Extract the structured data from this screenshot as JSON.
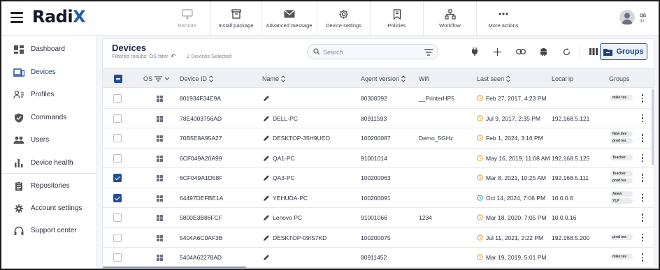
{
  "app": {
    "logo_text": "Radi",
    "logo_accent": "X"
  },
  "toolbar": [
    {
      "label": "Remote",
      "icon": "monitor-icon",
      "disabled": true
    },
    {
      "label": "Install package",
      "icon": "package-icon",
      "disabled": false
    },
    {
      "label": "Advanced message",
      "icon": "envelope-icon",
      "disabled": false
    },
    {
      "label": "Device settings",
      "icon": "gear-icon",
      "disabled": false
    },
    {
      "label": "Policies",
      "icon": "bookmark-icon",
      "disabled": false
    },
    {
      "label": "Workflow",
      "icon": "workflow-icon",
      "disabled": false
    },
    {
      "label": "More actions",
      "icon": "more-dots-icon",
      "disabled": false
    }
  ],
  "user": {
    "name": "qa",
    "sub": "qa"
  },
  "sidebar": {
    "items": [
      {
        "label": "Dashboard",
        "icon": "dashboard-icon"
      },
      {
        "label": "Devices",
        "icon": "devices-icon",
        "active": true
      },
      {
        "label": "Profiles",
        "icon": "profiles-icon"
      },
      {
        "label": "Commands",
        "icon": "shield-icon"
      },
      {
        "label": "Users",
        "icon": "users-icon"
      },
      {
        "label": "Device health",
        "icon": "bar-chart-icon"
      },
      {
        "label": "Repositories",
        "icon": "clipboard-icon"
      },
      {
        "label": "Account settings",
        "icon": "gear-icon"
      },
      {
        "label": "Support center",
        "icon": "headset-icon"
      }
    ]
  },
  "main": {
    "title": "Devices",
    "filter_text": "Filtered results: OS filter",
    "selected_text": "2 Devices Selected",
    "search_placeholder": "Search",
    "groups_button": "Groups",
    "accent_color": "#1f4f96"
  },
  "table": {
    "headers": {
      "os": "OS",
      "device_id": "Device ID",
      "name": "Name",
      "agent_version": "Agent version",
      "wifi": "Wifi",
      "last_seen": "Last seen",
      "local_ip": "Local ip",
      "groups": "Groups"
    },
    "rows": [
      {
        "checked": false,
        "device_id": "801934F34E9A",
        "name": "",
        "agent_version": "80300392",
        "wifi": "__PrinterHP5",
        "last_seen": "Feb 27, 2017, 4:23 PM",
        "local_ip": "",
        "groups": [
          "mike tes"
        ],
        "recent": false
      },
      {
        "checked": false,
        "device_id": "78E4003756AD",
        "name": "DELL-PC",
        "agent_version": "80911593",
        "wifi": "",
        "last_seen": "Jul 9, 2017, 2:35 PM",
        "local_ip": "192.168.5.121",
        "groups": [],
        "recent": false
      },
      {
        "checked": false,
        "device_id": "70B5E8A95A27",
        "name": "DESKTOP-35H9UEO",
        "agent_version": "100200087",
        "wifi": "Demo_5GHz",
        "last_seen": "Feb 1, 2024, 3:16 PM",
        "local_ip": "",
        "groups": [
          "New dev",
          "prod tes"
        ],
        "recent": false
      },
      {
        "checked": false,
        "device_id": "6CF049A20A99",
        "name": "QA1-PC",
        "agent_version": "91001014",
        "wifi": "",
        "last_seen": "May 16, 2019, 11:08 AM",
        "local_ip": "192.168.5.125",
        "groups": [
          "Teacher"
        ],
        "recent": false
      },
      {
        "checked": true,
        "device_id": "6CF049A1D58F",
        "name": "QA3-PC",
        "agent_version": "100200063",
        "wifi": "",
        "last_seen": "Mar 8, 2021, 10:25 AM",
        "local_ip": "192.168.5.111",
        "groups": [
          "Teacher",
          "prod tes"
        ],
        "recent": false
      },
      {
        "checked": true,
        "device_id": "64497DEFBE1A",
        "name": "YEHUDA-PC",
        "agent_version": "100200091",
        "wifi": "",
        "last_seen": "Oct 14, 2024, 7:06 PM",
        "local_ip": "10.0.0.6",
        "groups": [
          "Anew",
          "YLP"
        ],
        "recent": true
      },
      {
        "checked": false,
        "device_id": "5800E3B86FCF",
        "name": "Lenovo PC",
        "agent_version": "91001066",
        "wifi": "1234",
        "last_seen": "Mar 18, 2020, 7:05 PM",
        "local_ip": "10.0.0.16",
        "groups": [],
        "recent": false
      },
      {
        "checked": false,
        "device_id": "5404A6C0AF3B",
        "name": "DESKTOP-09IS7KD",
        "agent_version": "100200075",
        "wifi": "",
        "last_seen": "Jul 11, 2021, 2:22 PM",
        "local_ip": "192.168.5.200",
        "groups": [
          "prod tes"
        ],
        "recent": false
      },
      {
        "checked": false,
        "device_id": "5404A62278AD",
        "name": "",
        "agent_version": "80911452",
        "wifi": "",
        "last_seen": "Mar 19, 2019, 5:01 PM",
        "local_ip": "",
        "groups": [
          "mike tes"
        ],
        "recent": false
      }
    ]
  }
}
